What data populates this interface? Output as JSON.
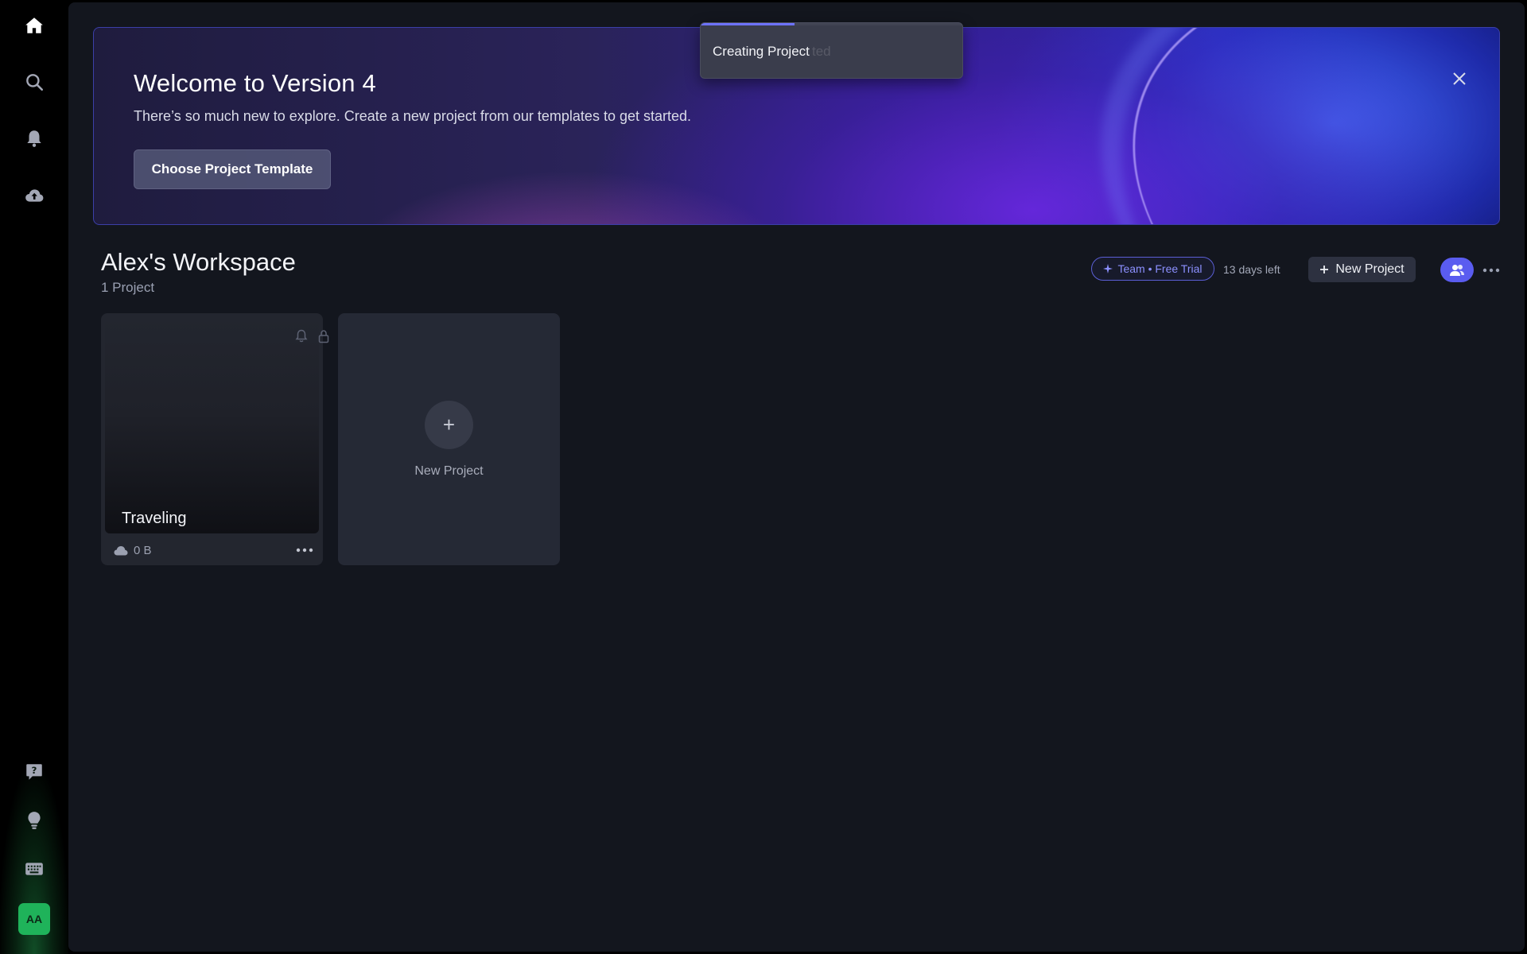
{
  "sidebar": {
    "icons": [
      "home-icon",
      "search-icon",
      "bell-icon",
      "cloud-upload-icon",
      "help-icon",
      "lightbulb-icon",
      "keyboard-icon"
    ],
    "avatar_initials": "AA",
    "avatar_color": "#1fb35a"
  },
  "banner": {
    "title": "Welcome to Version 4",
    "subtitle": "There’s so much new to explore. Create a new project from our templates to get started.",
    "button_label": "Choose Project Template"
  },
  "toast": {
    "text": "Creating Project",
    "ghost_text": "ted",
    "progress": 0.36
  },
  "workspace": {
    "title": "Alex's Workspace",
    "project_count": "1 Project",
    "plan_badge": "Team • Free Trial",
    "days_left": "13 days left",
    "new_project_label": "New Project",
    "accent": "#5a5cf0"
  },
  "projects": [
    {
      "name": "Traveling",
      "size": "0 B"
    }
  ],
  "new_card": {
    "plus": "+",
    "label": "New Project"
  }
}
